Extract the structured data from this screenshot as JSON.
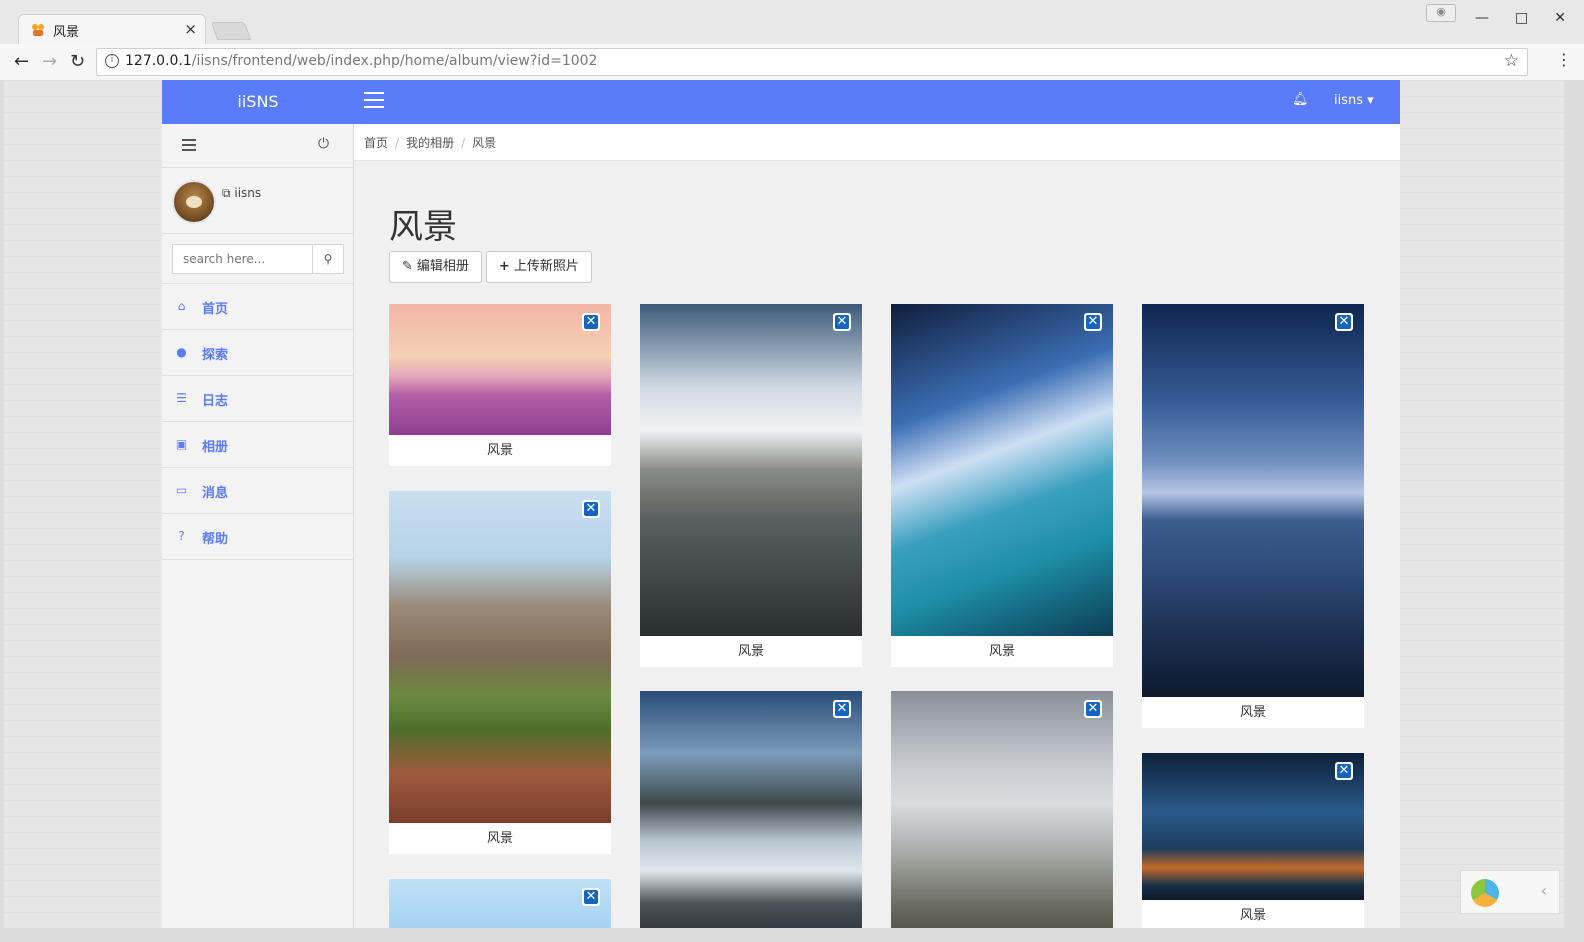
{
  "browser": {
    "tab_title": "风景",
    "url_host": "127.0.0.1",
    "url_path": "/iisns/frontend/web/index.php/home/album/view?id=1002",
    "tab_close": "×"
  },
  "app": {
    "brand": "iiSNS",
    "user_menu": "iisns ▾"
  },
  "sidebar": {
    "username": "iisns",
    "search_placeholder": "search here...",
    "items": [
      {
        "label": "首页",
        "icon": "home-icon"
      },
      {
        "label": "探索",
        "icon": "globe-icon"
      },
      {
        "label": "日志",
        "icon": "list-icon"
      },
      {
        "label": "相册",
        "icon": "picture-icon"
      },
      {
        "label": "消息",
        "icon": "inbox-icon"
      },
      {
        "label": "帮助",
        "icon": "question-icon"
      }
    ]
  },
  "breadcrumb": [
    "首页",
    "我的相册",
    "风景"
  ],
  "page": {
    "title": "风景",
    "edit_button": "编辑相册",
    "upload_button": "上传新照片"
  },
  "photos": [
    {
      "caption": "风景"
    },
    {
      "caption": "风景"
    },
    {
      "caption": "风景"
    },
    {
      "caption": "风景"
    },
    {
      "caption": "风景"
    },
    {
      "caption": "风景"
    },
    {
      "caption": "风景"
    },
    {
      "caption": "风景"
    },
    {
      "caption": ""
    }
  ],
  "colors": {
    "accent": "#5b7cfa",
    "delete_badge": "#1565c0"
  }
}
